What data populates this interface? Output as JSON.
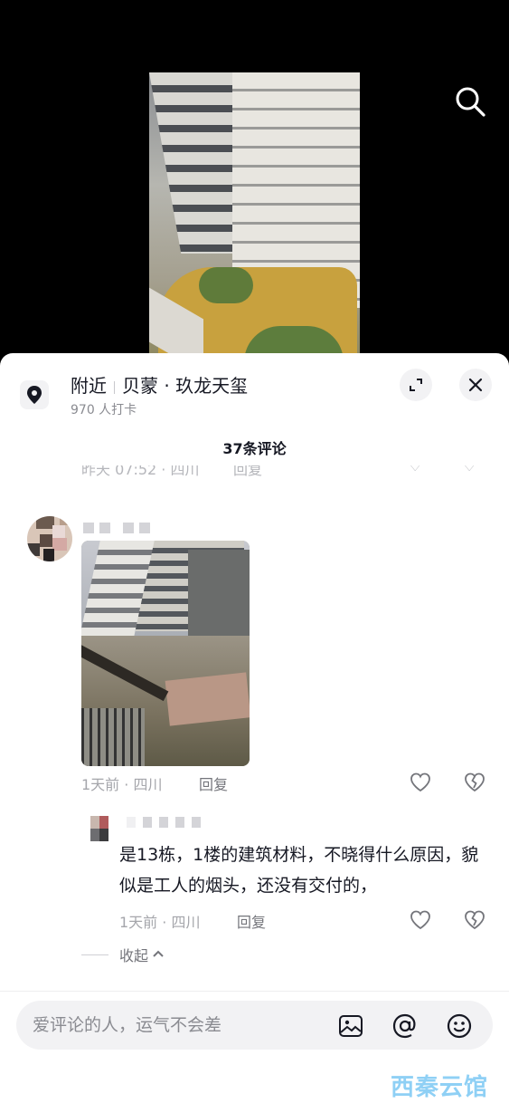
{
  "poi": {
    "label_nearby": "附近",
    "location_name": "贝蒙 · 玖龙天玺",
    "checkins": "970 人打卡"
  },
  "comments": {
    "count_label": "37条评论",
    "previous_cut_meta": "昨天 07:52 · 四川",
    "previous_cut_reply": "回复"
  },
  "comment": {
    "username": "",
    "time_location": "1天前 · 四川",
    "reply_label": "回复"
  },
  "reply": {
    "username": "",
    "text": "是13栋，1楼的建筑材料，不晓得什么原因，貌似是工人的烟头，还没有交付的，",
    "time_location": "1天前 · 四川",
    "reply_label": "回复"
  },
  "collapse_label": "收起",
  "input": {
    "placeholder": "爱评论的人，运气不会差"
  },
  "watermark": "西秦云馆",
  "icons": {
    "search": "search-icon",
    "location": "location-pin-icon",
    "expand": "expand-icon",
    "close": "close-icon",
    "like": "heart-icon",
    "dislike": "broken-heart-icon",
    "image": "image-icon",
    "mention": "at-icon",
    "emoji": "emoji-icon"
  },
  "colors": {
    "text_primary": "#161823",
    "text_secondary": "#a5a6ab",
    "input_bg": "#f2f2f4"
  }
}
